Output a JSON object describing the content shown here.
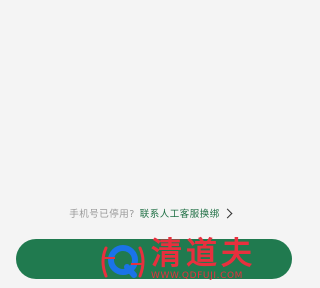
{
  "help": {
    "question": "手机号已停用?",
    "link_label": "联系人工客服换绑"
  },
  "primary_button": {
    "label": ""
  },
  "watermark": {
    "brand": "清道夫",
    "url": "WWW.QDFUJI.COM"
  },
  "colors": {
    "background": "#f4f4f4",
    "accent_green": "#207a4f",
    "link_green": "#1f6f44",
    "watermark_red": "#e8303e"
  },
  "icons": {
    "help_link_arrow": "chevron-right-icon",
    "watermark_logo": "q-logo-icon"
  }
}
